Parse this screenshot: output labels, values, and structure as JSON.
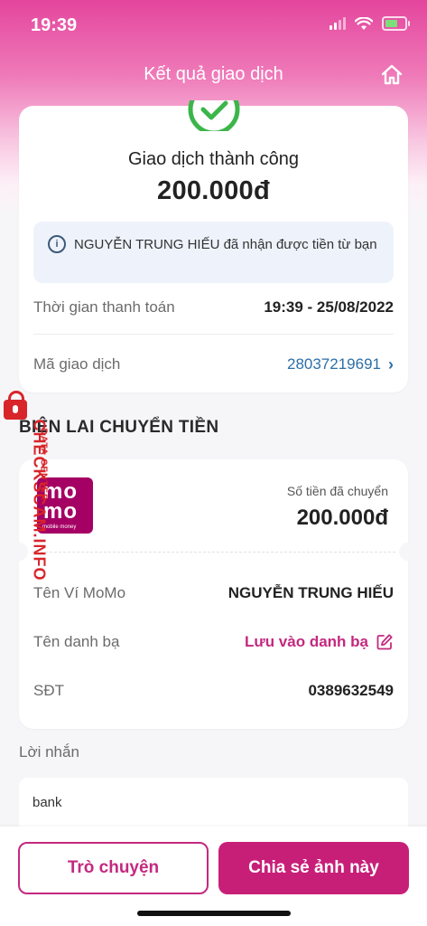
{
  "status_bar": {
    "time": "19:39"
  },
  "header": {
    "title": "Kết quả giao dịch"
  },
  "summary": {
    "status": "Giao dịch thành công",
    "amount": "200.000đ",
    "notice": "NGUYỄN TRUNG HIẾU đã nhận được tiền từ bạn",
    "payment_time_label": "Thời gian thanh toán",
    "payment_time_value": "19:39 - 25/08/2022",
    "transaction_id_label": "Mã giao dịch",
    "transaction_id_value": "28037219691"
  },
  "receipt": {
    "section_title": "BIÊN LAI CHUYỂN TIỀN",
    "logo": {
      "line1": "mo",
      "line2": "mo",
      "tagline": "mobile money"
    },
    "sent_label": "Số tiền đã chuyển",
    "sent_amount": "200.000đ",
    "wallet_name_label": "Tên Ví MoMo",
    "wallet_name_value": "NGUYỄN TRUNG HIẾU",
    "contact_label": "Tên danh bạ",
    "contact_action": "Lưu vào danh bạ",
    "phone_label": "SĐT",
    "phone_value": "0389632549"
  },
  "message": {
    "label": "Lời nhắn",
    "text": "bank"
  },
  "actions": {
    "chat": "Trò chuyện",
    "share": "Chia sẻ ảnh này"
  },
  "watermark": {
    "main": "CHECKSCAM.INFO",
    "sub": "DATA CENTER"
  },
  "colors": {
    "brand": "#c71f78",
    "link": "#2c6fa8",
    "success": "#3cb54a",
    "watermark": "#d8252a"
  }
}
